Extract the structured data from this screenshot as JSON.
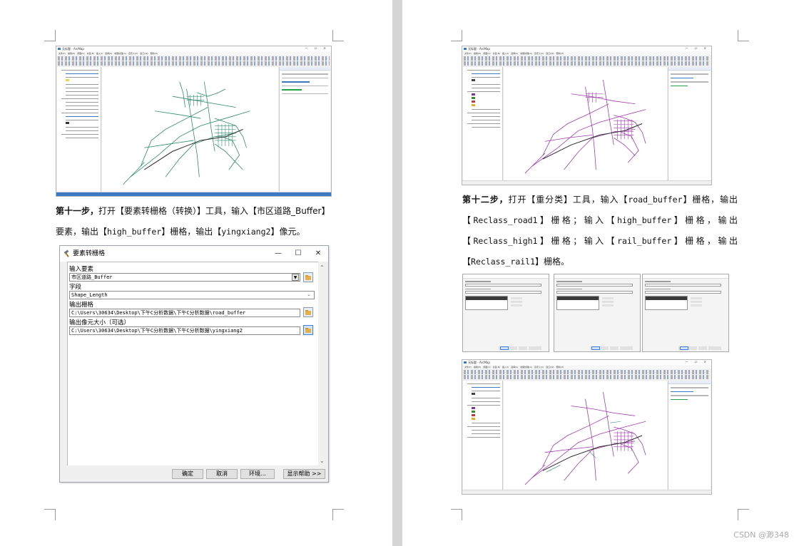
{
  "document": {
    "left_page": {
      "step_label": "第十一步，",
      "paragraph_parts": [
        "打开【要素转栅格（转换）】工具，输入【市区道路_Buffer】",
        "要素，输出【",
        "high_buffer",
        "】栅格，输出【",
        "yingxiang2",
        "】像元。"
      ]
    },
    "right_page": {
      "step_label": "第十二步，",
      "line1_parts": [
        "打开【重分类】工具，输入【",
        "road_buffer",
        "】栅格，输出"
      ],
      "line2_parts": [
        "【",
        "Reclass_road1",
        "】栅格；输入【",
        "high_buffer",
        "】栅格，输出"
      ],
      "line3_parts": [
        "【",
        "Reclass_high1",
        "】栅格；输入【",
        "rail_buffer",
        "】栅格，输出"
      ],
      "line4_parts": [
        "【",
        "Reclass_rail1",
        "】栅格。"
      ]
    }
  },
  "dialog": {
    "title": "要素转栅格",
    "window_buttons": {
      "minimize": "—",
      "maximize": "☐",
      "close": "✕"
    },
    "fields": [
      {
        "label": "输入要素",
        "value": "市区道路_Buffer"
      },
      {
        "label": "字段",
        "value": "Shape_Length"
      },
      {
        "label": "输出栅格",
        "value": "C:\\Users\\30634\\Desktop\\下午C分析数据\\下午C分析数据\\road_buffer"
      },
      {
        "label": "输出像元大小（可选）",
        "value": "C:\\Users\\30634\\Desktop\\下午C分析数据\\下午C分析数据\\yingxiang2"
      }
    ],
    "buttons": {
      "ok": "确定",
      "cancel": "取消",
      "env": "环境...",
      "help": "显示帮助 >>"
    }
  },
  "arcmap": {
    "window_title": "无标题 - ArcMap",
    "menu": "文件(F) 编辑(E) 视图(V) 书签(B) 插入(I) 选择(S) 地理处理(G) 自定义(C) 窗口(W) 帮助(H)",
    "window_buttons": "— ☐ ✕"
  },
  "colors": {
    "road_green": "#2e8b6e",
    "road_purple": "#a23ab0",
    "rail_dark": "#2b2b2b",
    "selection_blue": "#3a78c4"
  },
  "watermark": "CSDN @渺348"
}
